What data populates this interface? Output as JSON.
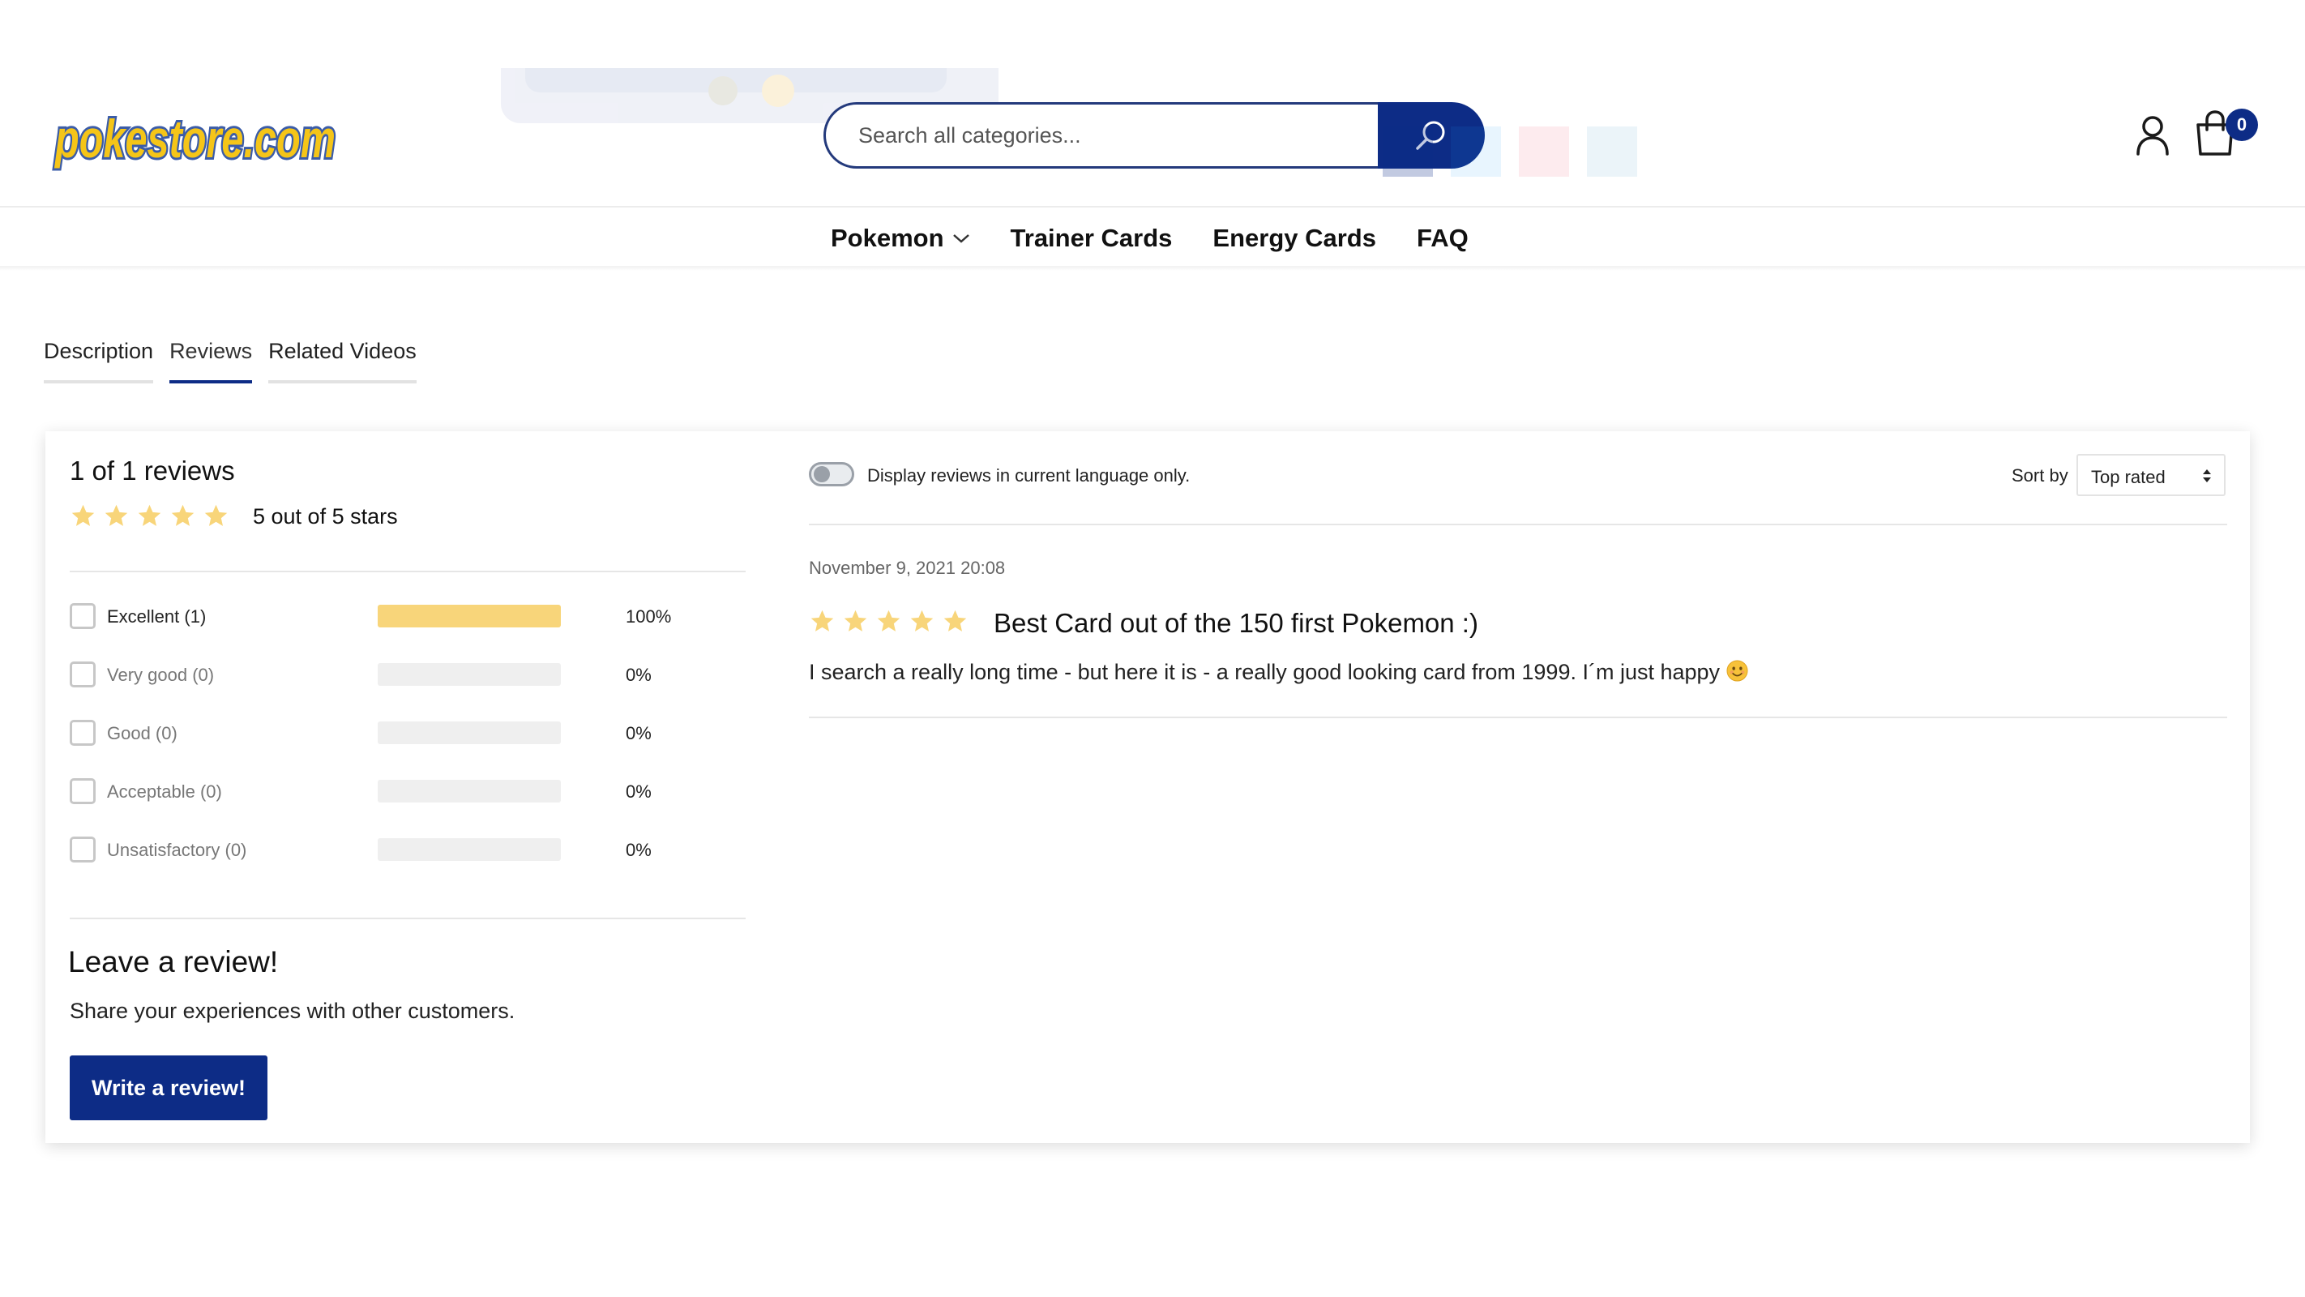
{
  "header": {
    "logo_text": "pokestore.com",
    "search": {
      "placeholder": "Search all categories..."
    },
    "cart": {
      "count": "0"
    }
  },
  "nav": {
    "items": [
      {
        "label": "Pokemon",
        "has_dropdown": true
      },
      {
        "label": "Trainer Cards",
        "has_dropdown": false
      },
      {
        "label": "Energy Cards",
        "has_dropdown": false
      },
      {
        "label": "FAQ",
        "has_dropdown": false
      }
    ]
  },
  "tabs": [
    {
      "label": "Description",
      "active": false
    },
    {
      "label": "Reviews",
      "active": true
    },
    {
      "label": "Related Videos",
      "active": false
    }
  ],
  "summary": {
    "title": "1 of 1 reviews",
    "stars": 5,
    "text": "5 out of 5 stars",
    "ratings": [
      {
        "label": "Excellent (1)",
        "fraction": 1.0,
        "percent": "100%"
      },
      {
        "label": "Very good (0)",
        "fraction": 0.0,
        "percent": "0%"
      },
      {
        "label": "Good (0)",
        "fraction": 0.0,
        "percent": "0%"
      },
      {
        "label": "Acceptable (0)",
        "fraction": 0.0,
        "percent": "0%"
      },
      {
        "label": "Unsatisfactory (0)",
        "fraction": 0.0,
        "percent": "0%"
      }
    ]
  },
  "leave_review": {
    "title": "Leave a review!",
    "subtitle": "Share your experiences with other customers.",
    "button_label": "Write a review!"
  },
  "filters": {
    "language_toggle_label": "Display reviews in current language only.",
    "language_toggle_on": false,
    "sort_label": "Sort by",
    "sort_value": "Top rated"
  },
  "reviews": [
    {
      "date": "November 9, 2021 20:08",
      "stars": 5,
      "title": "Best Card out of the 150 first Pokemon :)",
      "body": "I search a really long time - but here it is - a really good looking card from 1999. I´m just happy"
    }
  ],
  "colors": {
    "brand_blue": "#0d2c86",
    "star_yellow": "#f8d57a",
    "bar_empty": "#efefef",
    "logo_yellow": "#f5c518",
    "logo_outline": "#3b5ca8"
  }
}
